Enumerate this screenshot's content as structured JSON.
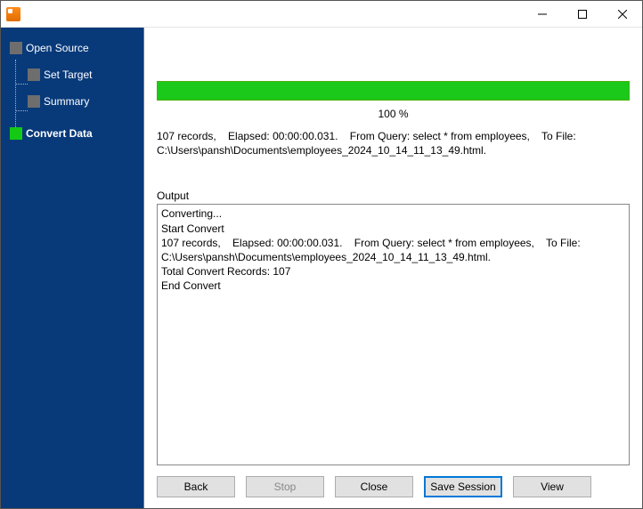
{
  "window": {
    "title": ""
  },
  "sidebar": {
    "items": [
      {
        "label": "Open Source",
        "active": false,
        "level": 0
      },
      {
        "label": "Set Target",
        "active": false,
        "level": 1
      },
      {
        "label": "Summary",
        "active": false,
        "level": 1
      },
      {
        "label": "Convert Data",
        "active": true,
        "level": 0
      }
    ]
  },
  "progress": {
    "percent_label": "100 %",
    "percent_value": 100
  },
  "summary": "107 records,    Elapsed: 00:00:00.031.    From Query: select * from employees,    To File: C:\\Users\\pansh\\Documents\\employees_2024_10_14_11_13_49.html.",
  "output": {
    "label": "Output",
    "lines": [
      "Converting...",
      "Start Convert",
      "107 records,    Elapsed: 00:00:00.031.    From Query: select * from employees,    To File: C:\\Users\\pansh\\Documents\\employees_2024_10_14_11_13_49.html.",
      "Total Convert Records: 107",
      "End Convert"
    ]
  },
  "buttons": {
    "back": "Back",
    "stop": "Stop",
    "close": "Close",
    "save_session": "Save Session",
    "view": "View"
  }
}
